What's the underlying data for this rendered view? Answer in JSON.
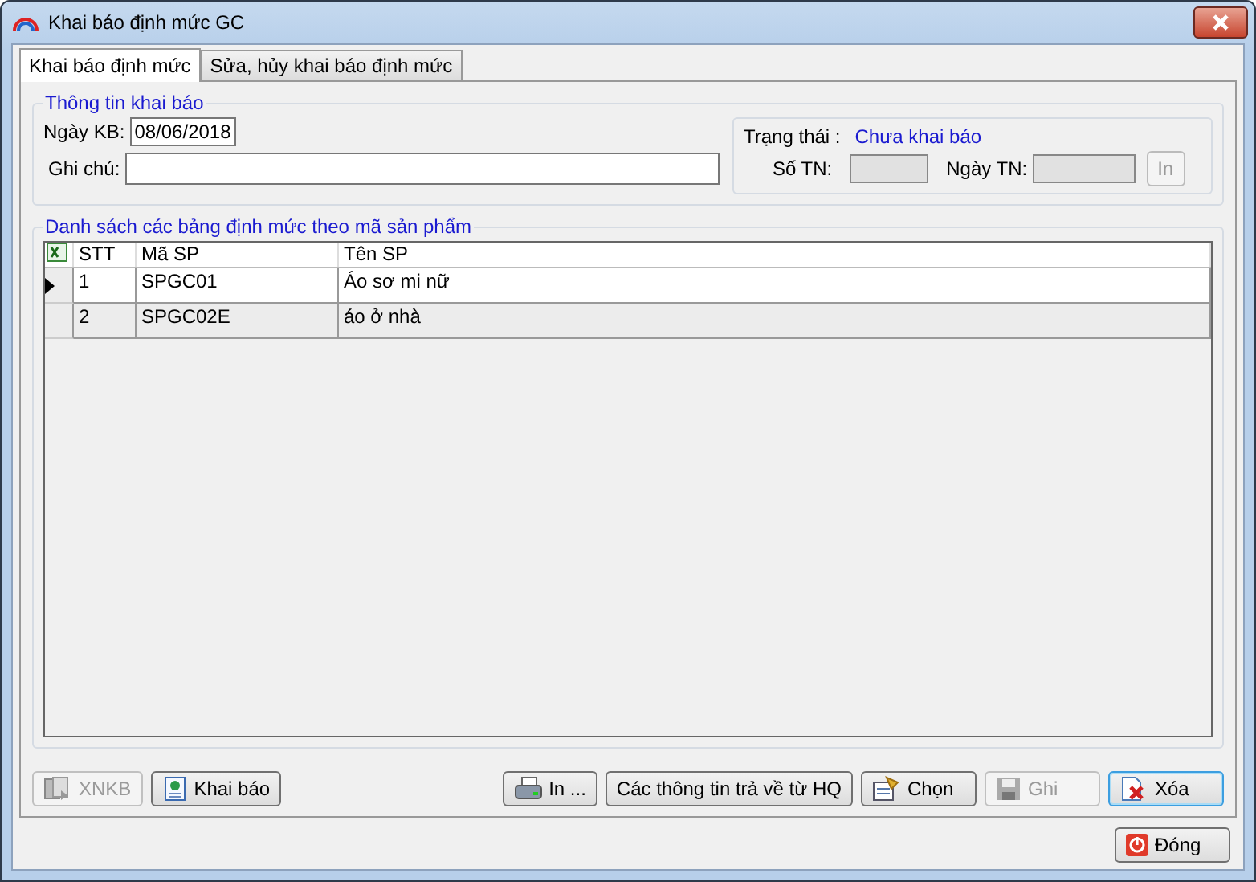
{
  "window": {
    "title": "Khai báo định mức GC"
  },
  "tabs": [
    {
      "label": "Khai báo định mức",
      "selected": true
    },
    {
      "label": "Sửa, hủy khai báo định mức",
      "selected": false
    }
  ],
  "info_group": {
    "title": "Thông tin khai báo",
    "date_label": "Ngày KB:",
    "date_value": "08/06/2018",
    "note_label": "Ghi chú:",
    "status_label": "Trạng thái :",
    "status_value": "Chưa khai báo",
    "so_tn_label": "Số TN:",
    "ngay_tn_label": "Ngày TN:",
    "print_button": {
      "label": "In",
      "disabled": true
    }
  },
  "list_group": {
    "title": "Danh sách các bảng định mức theo mã sản phẩm",
    "columns": [
      "STT",
      "Mã SP",
      "Tên SP"
    ],
    "rows": [
      {
        "cells": [
          "1",
          "SPGC01",
          "Áo sơ mi nữ"
        ],
        "selected": true
      },
      {
        "cells": [
          "2",
          "SPGC02E",
          "áo ở nhà"
        ],
        "selected": false
      }
    ]
  },
  "buttons": [
    {
      "kind": "xnkb",
      "label": "XNKB",
      "disabled": true,
      "focused": false
    },
    {
      "kind": "declare",
      "label": "Khai báo",
      "disabled": false,
      "focused": false
    },
    {
      "kind": "spacer"
    },
    {
      "kind": "print",
      "label": "In ...",
      "disabled": false,
      "focused": false
    },
    {
      "kind": "text",
      "label": "Các thông tin trả về từ HQ",
      "disabled": false,
      "focused": false
    },
    {
      "kind": "choose",
      "label": "Chọn",
      "disabled": false,
      "focused": false
    },
    {
      "kind": "save",
      "label": "Ghi",
      "disabled": true,
      "focused": false
    },
    {
      "kind": "delete",
      "label": "Xóa",
      "disabled": false,
      "focused": true
    }
  ],
  "close_button": {
    "label": "Đóng"
  }
}
